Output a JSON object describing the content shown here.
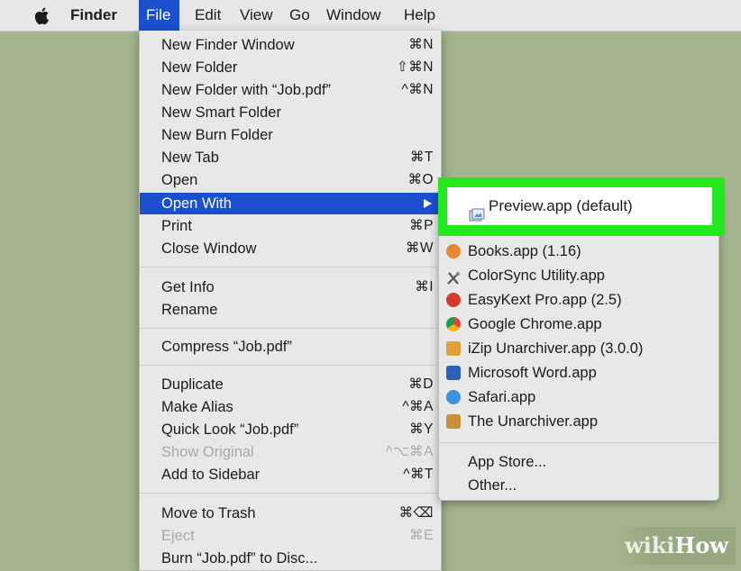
{
  "menubar": {
    "apple_icon": "apple-icon",
    "items": [
      "Finder",
      "File",
      "Edit",
      "View",
      "Go",
      "Window",
      "Help"
    ]
  },
  "file_menu": {
    "items": [
      {
        "label": "New Finder Window",
        "shortcut": "⌘N"
      },
      {
        "label": "New Folder",
        "shortcut": "⇧⌘N"
      },
      {
        "label": "New Folder with “Job.pdf”",
        "shortcut": "^⌘N"
      },
      {
        "label": "New Smart Folder",
        "shortcut": ""
      },
      {
        "label": "New Burn Folder",
        "shortcut": ""
      },
      {
        "label": "New Tab",
        "shortcut": "⌘T"
      },
      {
        "label": "Open",
        "shortcut": "⌘O"
      },
      {
        "label": "Open With",
        "shortcut": ""
      },
      {
        "label": "Print",
        "shortcut": "⌘P"
      },
      {
        "label": "Close Window",
        "shortcut": "⌘W"
      },
      {
        "label": "Get Info",
        "shortcut": "⌘I"
      },
      {
        "label": "Rename",
        "shortcut": ""
      },
      {
        "label": "Compress “Job.pdf”",
        "shortcut": ""
      },
      {
        "label": "Duplicate",
        "shortcut": "⌘D"
      },
      {
        "label": "Make Alias",
        "shortcut": "^⌘A"
      },
      {
        "label": "Quick Look “Job.pdf”",
        "shortcut": "⌘Y"
      },
      {
        "label": "Show Original",
        "shortcut": "^⌥⌘A"
      },
      {
        "label": "Add to Sidebar",
        "shortcut": "^⌘T"
      },
      {
        "label": "Move to Trash",
        "shortcut": "⌘⌫"
      },
      {
        "label": "Eject",
        "shortcut": "⌘E"
      },
      {
        "label": "Burn “Job.pdf” to Disc...",
        "shortcut": ""
      }
    ]
  },
  "open_with_menu": {
    "default_app": "Preview.app (default)",
    "apps": [
      {
        "label": "Books.app (1.16)",
        "icon": "books-icon",
        "color": "#e58a2c"
      },
      {
        "label": "ColorSync Utility.app",
        "icon": "colorsync-icon",
        "color": "#555555"
      },
      {
        "label": "EasyKext Pro.app (2.5)",
        "icon": "easykext-icon",
        "color": "#d43b2f"
      },
      {
        "label": "Google Chrome.app",
        "icon": "chrome-icon",
        "color": "#e9a61b"
      },
      {
        "label": "iZip Unarchiver.app (3.0.0)",
        "icon": "izip-icon",
        "color": "#e0a03a"
      },
      {
        "label": "Microsoft Word.app",
        "icon": "word-icon",
        "color": "#2b5fb8"
      },
      {
        "label": "Safari.app",
        "icon": "safari-icon",
        "color": "#3d8fe0"
      },
      {
        "label": "The Unarchiver.app",
        "icon": "unarchiver-icon",
        "color": "#c8903a"
      }
    ],
    "extra": [
      "App Store...",
      "Other..."
    ]
  },
  "colors": {
    "desktop": "#a3b48e",
    "highlight": "#1a4fcf",
    "callout": "#22e81c"
  },
  "watermark": {
    "part1": "wiki",
    "part2": "How"
  }
}
